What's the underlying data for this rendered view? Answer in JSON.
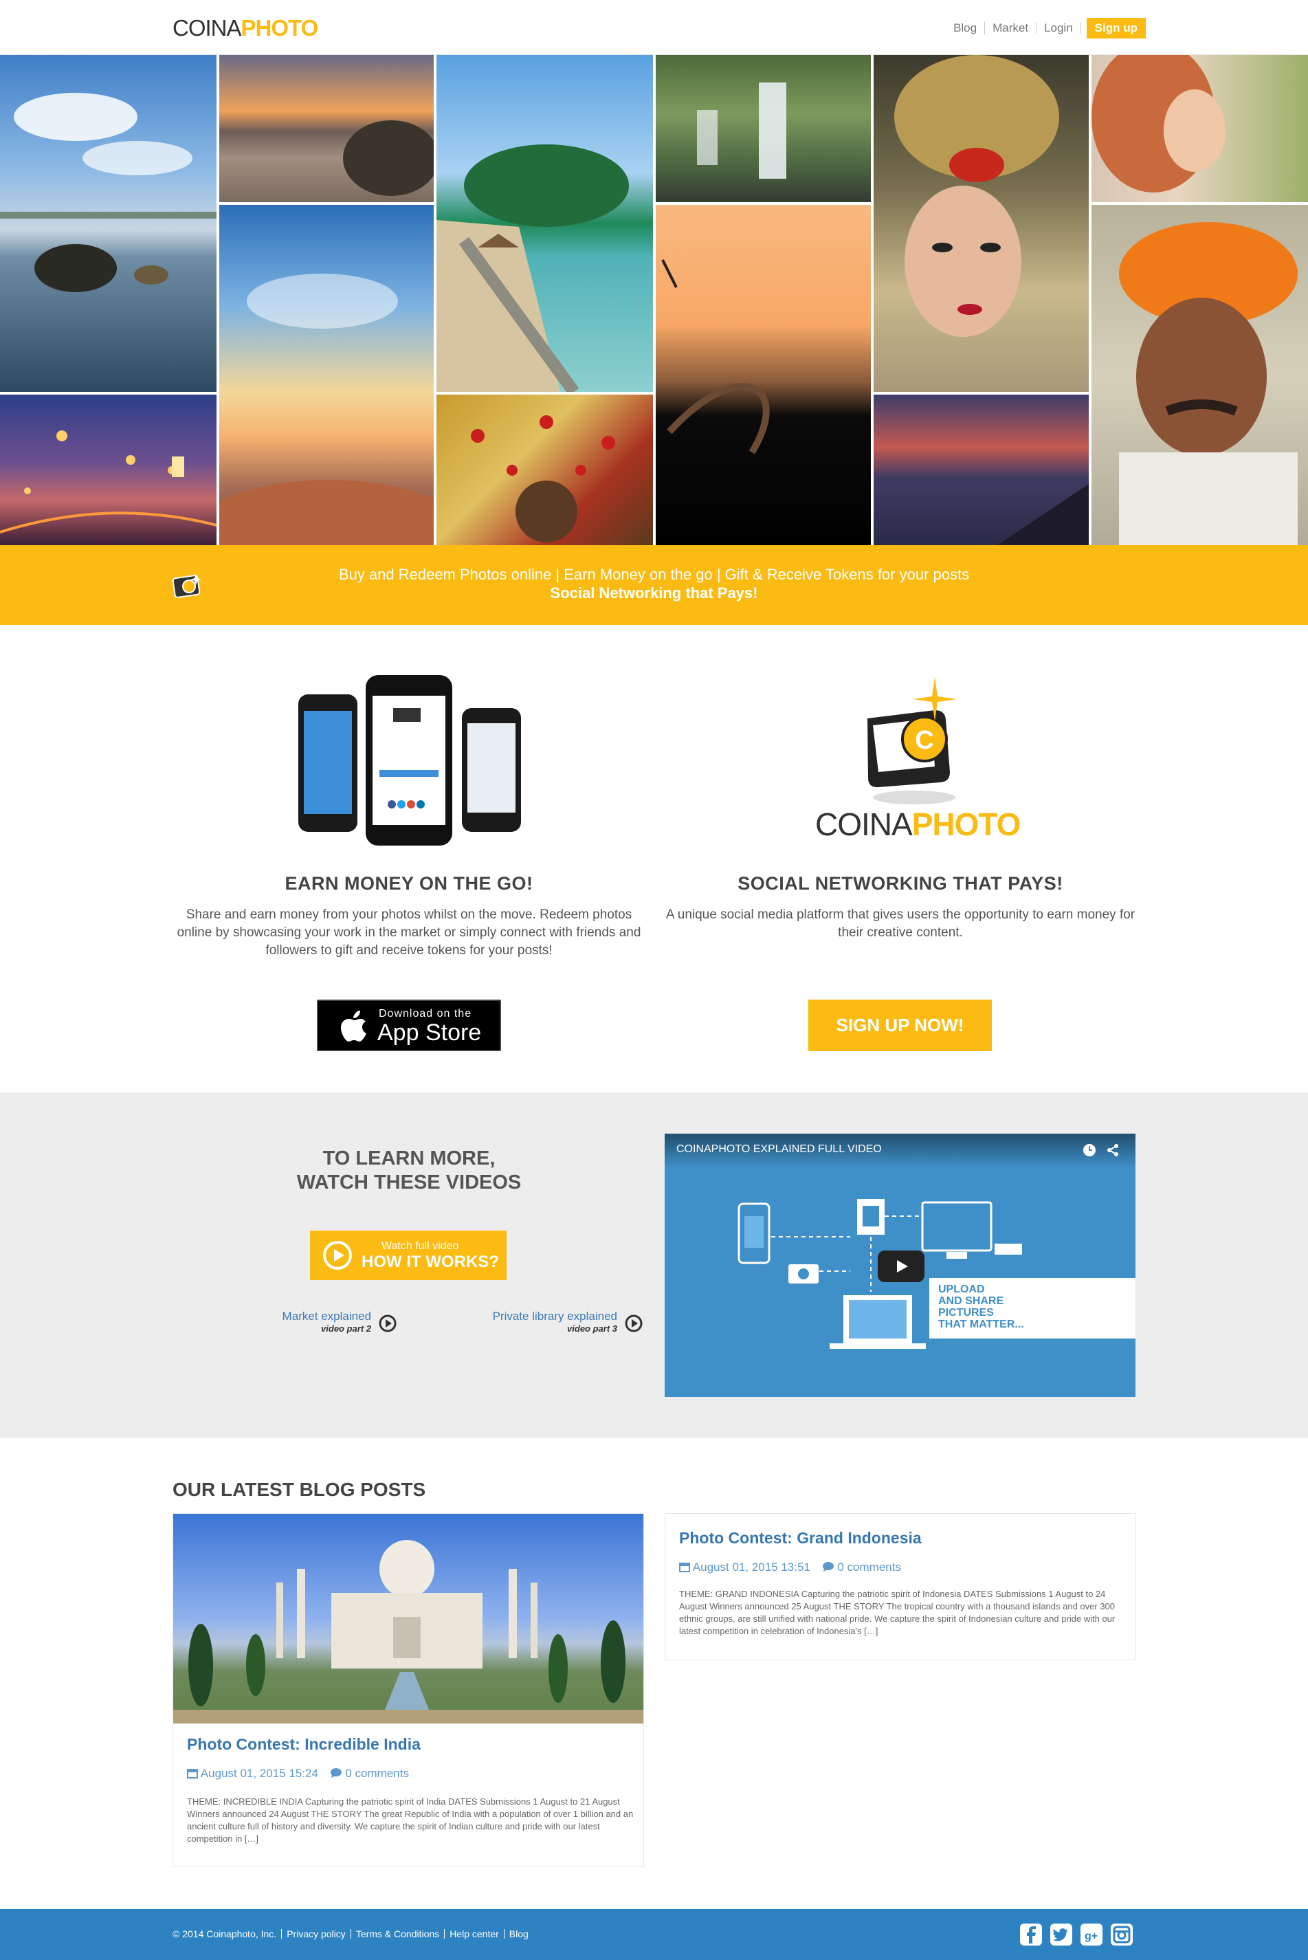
{
  "header": {
    "logo_part1": "COINA",
    "logo_part2": "PHOTO",
    "nav": {
      "blog": "Blog",
      "market": "Market",
      "login": "Login",
      "signup": "Sign up"
    }
  },
  "banner": {
    "line1": "Buy and Redeem Photos online | Earn Money on the go | Gift & Receive Tokens for your posts",
    "line2": "Social Networking that Pays!"
  },
  "features": {
    "left": {
      "title": "EARN MONEY ON THE GO!",
      "text": "Share and earn money from your photos whilst on the move. Redeem photos online by showcasing your work in the market or simply connect with friends and followers to gift and receive tokens for your posts!",
      "appstore_small": "Download on the",
      "appstore_big": "App Store"
    },
    "right": {
      "logo_part1": "COINA",
      "logo_part2": "PHOTO",
      "title": "SOCIAL NETWORKING THAT PAYS!",
      "text": "A unique social media platform that gives users the opportunity to earn money for their creative content.",
      "button": "SIGN UP NOW!"
    }
  },
  "videos": {
    "heading_line1": "TO LEARN MORE,",
    "heading_line2": "WATCH THESE VIDEOS",
    "how_small": "Watch full video",
    "how_big": "HOW IT WORKS?",
    "link1_title": "Market explained",
    "link1_sub": "video part 2",
    "link2_title": "Private library explained",
    "link2_sub": "video part 3",
    "player_title": "COINAPHOTO EXPLAINED FULL VIDEO",
    "player_caption": [
      "UPLOAD",
      "AND SHARE",
      "PICTURES",
      "THAT MATTER..."
    ]
  },
  "blog": {
    "heading": "OUR LATEST BLOG POSTS",
    "posts": [
      {
        "title": "Photo Contest: Incredible India",
        "date": "August 01, 2015 15:24",
        "comments": "0 comments",
        "excerpt": "THEME: INCREDIBLE INDIA Capturing the patriotic spirit of India DATES Submissions 1 August to 21 August Winners announced 24 August THE STORY The great Republic of India with a population of over 1 billion and an ancient culture full of history and diversity. We capture the spirit of Indian culture and pride with our latest competition in […]"
      },
      {
        "title": "Photo Contest: Grand Indonesia",
        "date": "August 01, 2015 13:51",
        "comments": "0 comments",
        "excerpt": "THEME: GRAND INDONESIA Capturing the patriotic spirit of Indonesia DATES Submissions 1 August to 24 August Winners announced 25 August THE STORY The tropical country with a thousand islands and over 300 ethnic groups, are still unified with national pride. We capture the spirit of Indonesian culture and pride with our latest competition in celebration of Indonesia's […]"
      }
    ]
  },
  "footer": {
    "copyright": "© 2014 Coinaphoto, Inc.",
    "links": [
      "Privacy policy",
      "Terms & Conditions",
      "Help center",
      "Blog"
    ]
  },
  "colors": {
    "accent": "#fbbb13",
    "blue": "#2d82c2",
    "link": "#3777b0"
  }
}
